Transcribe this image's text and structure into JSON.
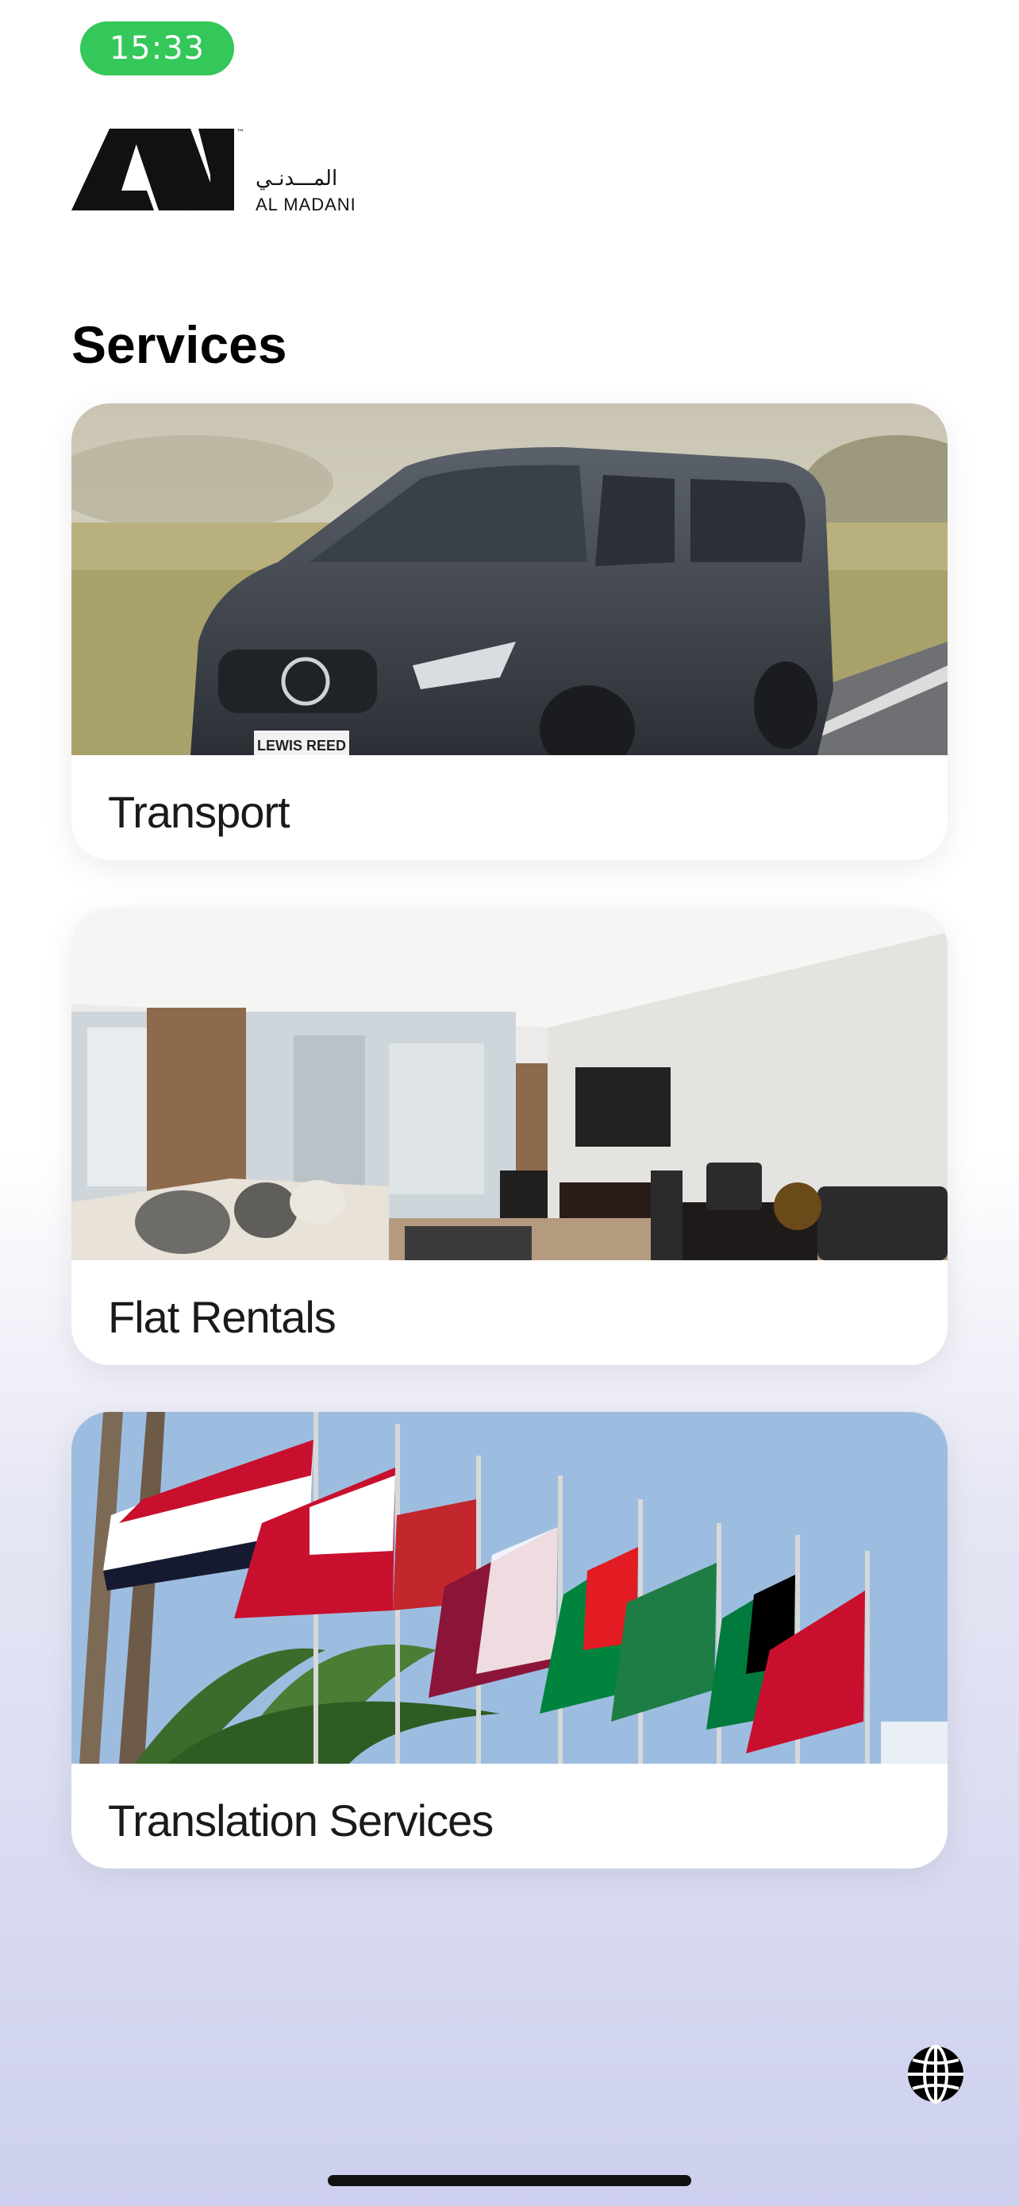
{
  "status_bar": {
    "time": "15:33",
    "pill_color": "#34c759"
  },
  "logo": {
    "arabic_text": "المـــدنـي",
    "latin_text": "AL MADANI",
    "mark": "AM"
  },
  "page": {
    "title": "Services"
  },
  "services": [
    {
      "label": "Transport",
      "image": "van-photo"
    },
    {
      "label": "Flat Rentals",
      "image": "living-room-photo"
    },
    {
      "label": "Translation Services",
      "image": "flags-photo"
    }
  ],
  "language_button": {
    "icon": "globe-icon"
  },
  "colors": {
    "accent_bg_bottom": "#cdd0ee",
    "text": "#000000"
  }
}
